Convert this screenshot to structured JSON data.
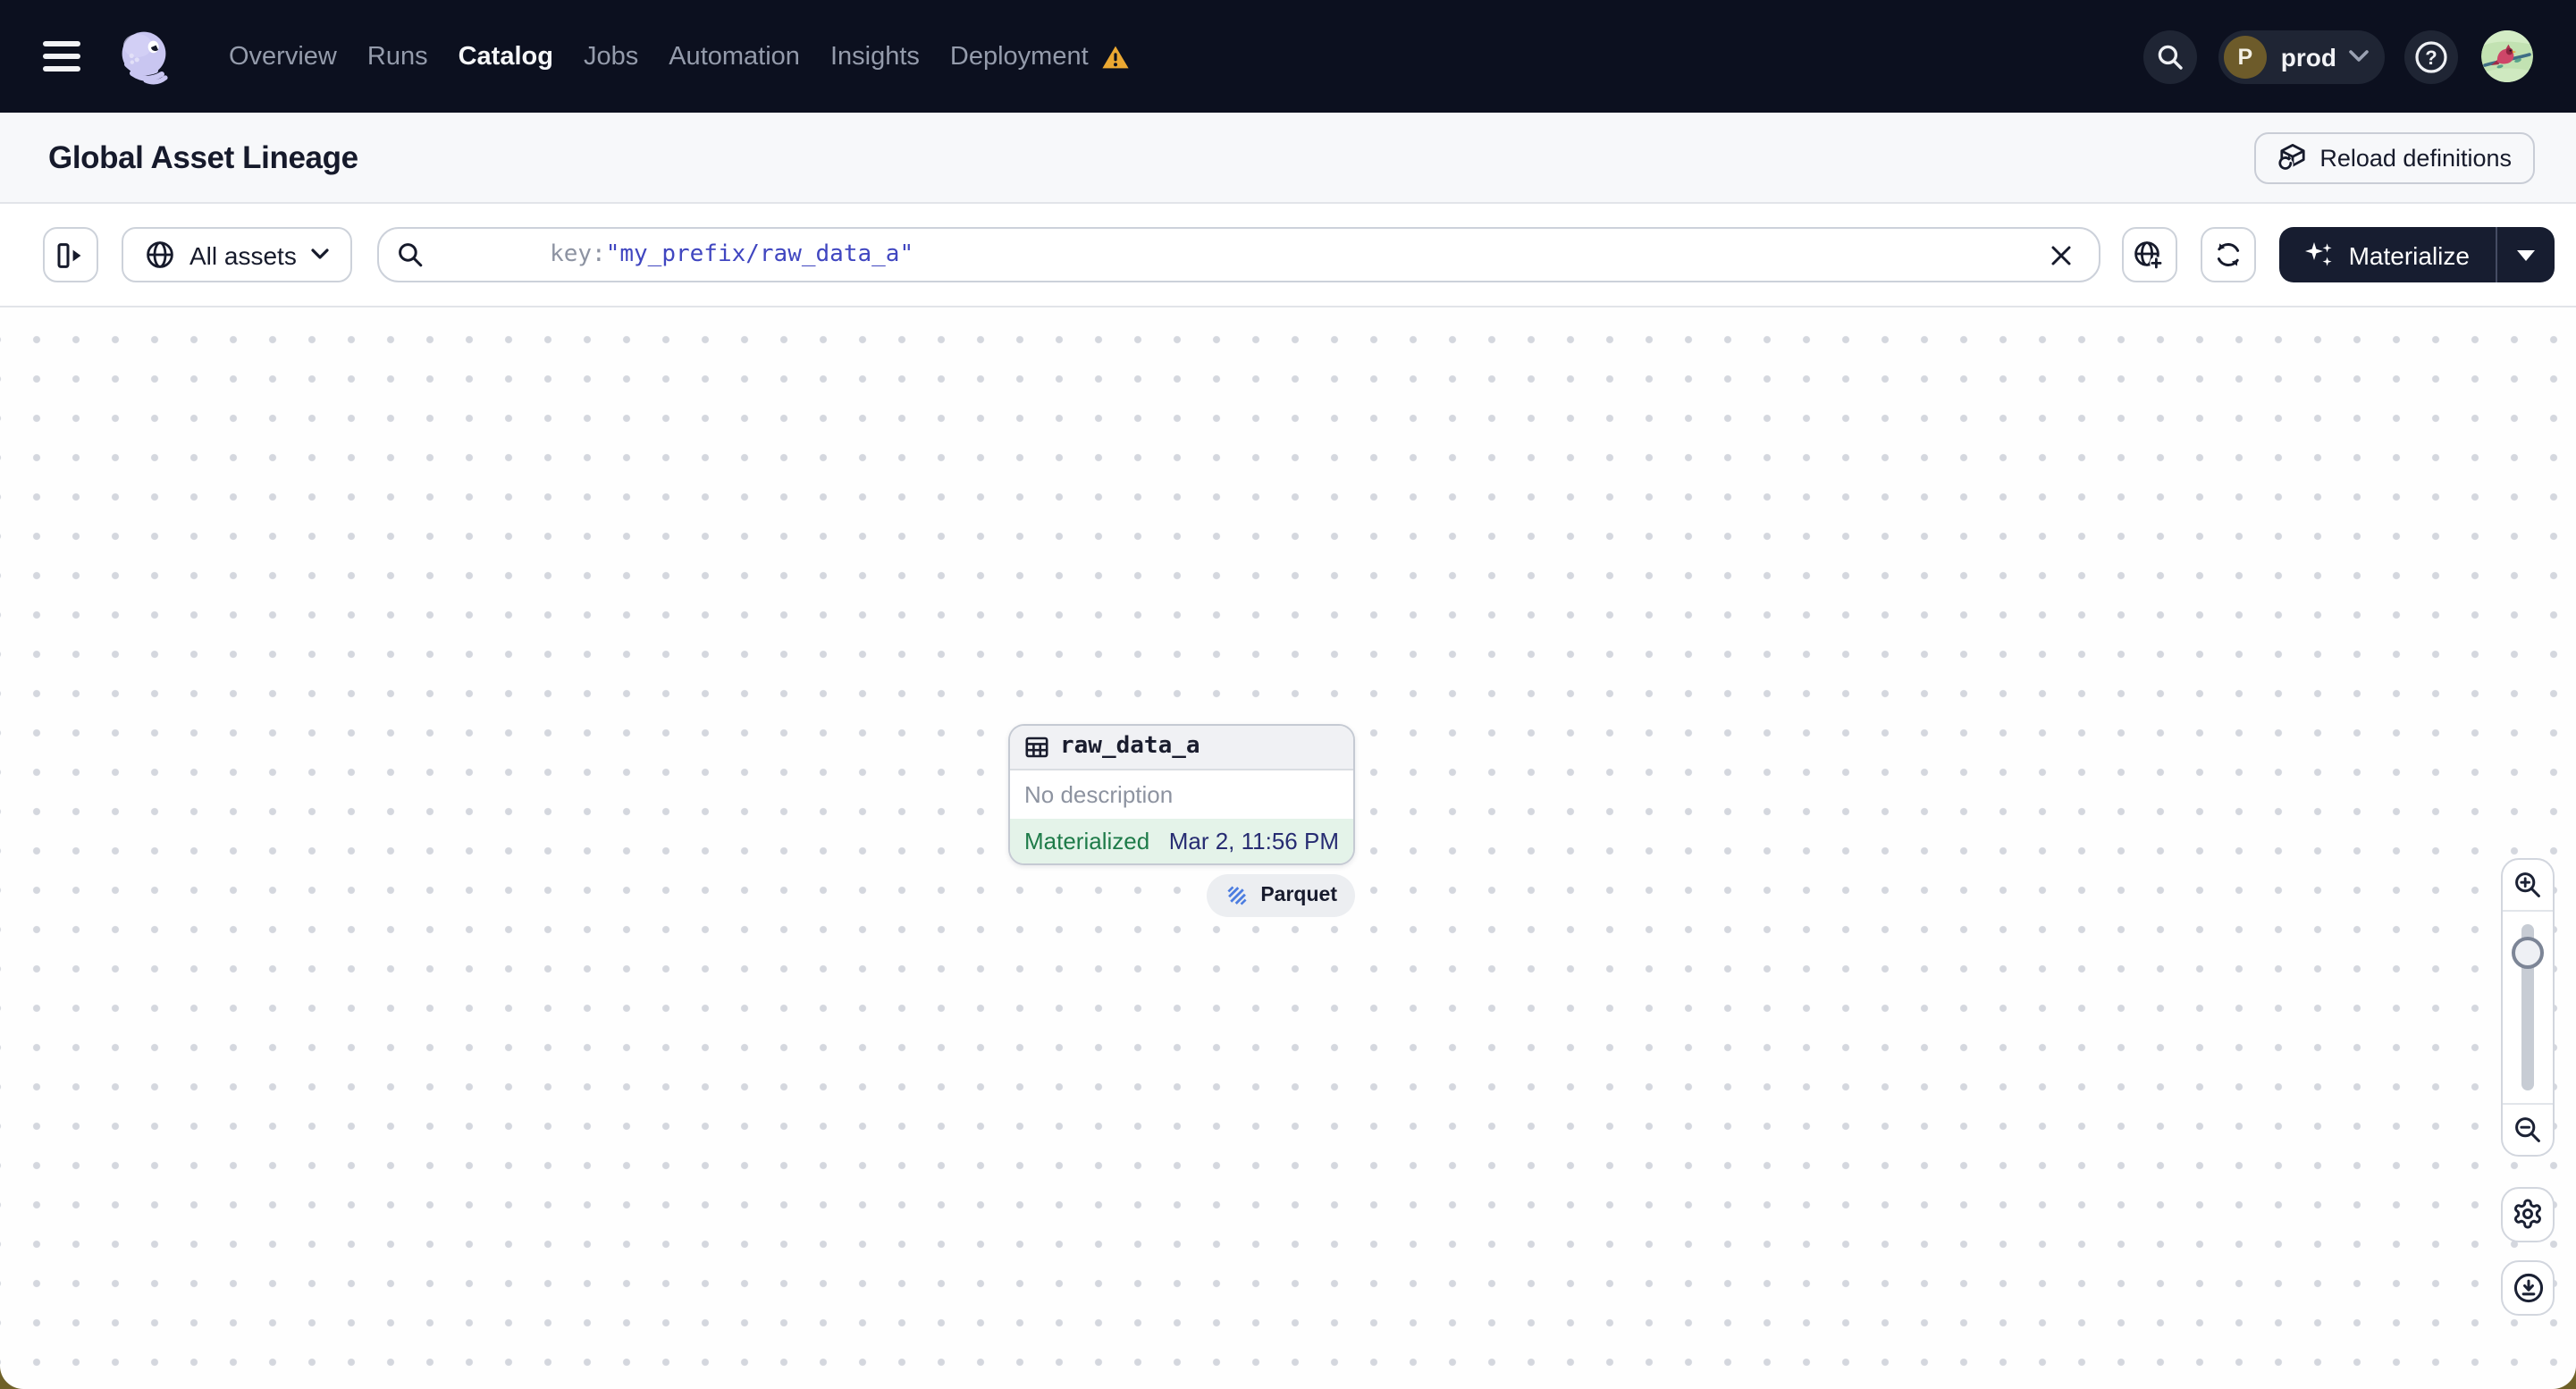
{
  "nav": {
    "items": [
      "Overview",
      "Runs",
      "Catalog",
      "Jobs",
      "Automation",
      "Insights",
      "Deployment"
    ],
    "active_item": "Catalog",
    "environment": {
      "initial": "P",
      "name": "prod"
    },
    "help_glyph": "?"
  },
  "page": {
    "title": "Global Asset Lineage",
    "reload_button_label": "Reload definitions"
  },
  "toolbar": {
    "scope_button_label": "All assets",
    "search": {
      "prefix": "key:",
      "value": "\"my_prefix/raw_data_a\""
    },
    "materialize_label": "Materialize"
  },
  "graph": {
    "node": {
      "name": "raw_data_a",
      "description": "No description",
      "status": "Materialized",
      "materialized_at": "Mar 2, 11:56 PM",
      "kind_tag": "Parquet"
    }
  },
  "colors": {
    "nav_background": "#0c101f",
    "accent_indigo": "#4046c0",
    "materialized_green": "#1e7b49",
    "materialized_bg": "#e4f3e9",
    "warning_amber": "#eba832",
    "materialize_button_bg": "#171d30"
  }
}
